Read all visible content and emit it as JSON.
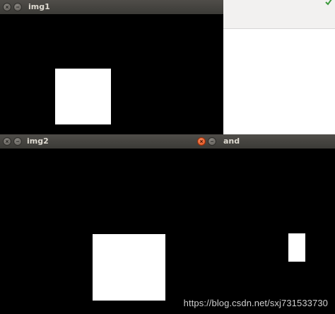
{
  "windows": {
    "img1": {
      "title": "img1"
    },
    "img2": {
      "title": "img2"
    },
    "and": {
      "title": "and"
    }
  },
  "background_window": {
    "icon": "check-icon",
    "accent": "#3c9a3c"
  },
  "colors": {
    "canvas": "#000000",
    "shape": "#ffffff",
    "titlebar": "#3c3b37",
    "close_active": "#df4a16"
  },
  "icons": {
    "close": "close-icon",
    "minimize": "minimize-icon"
  },
  "watermark": "https://blog.csdn.net/sxj731533730"
}
